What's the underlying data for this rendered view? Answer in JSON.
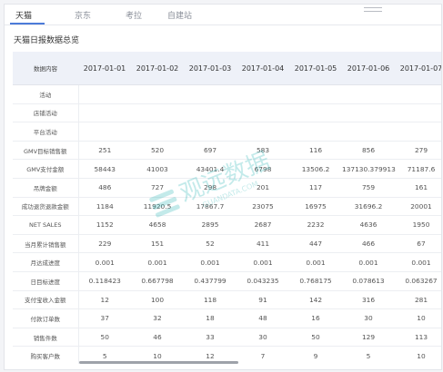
{
  "tabs": [
    {
      "label": "天猫",
      "active": true
    },
    {
      "label": "京东",
      "active": false
    },
    {
      "label": "考拉",
      "active": false
    },
    {
      "label": "自建站",
      "active": false
    }
  ],
  "panel": {
    "title": "天猫日报数据总览"
  },
  "table": {
    "corner_header": "数据内容",
    "dates": [
      "2017-01-01",
      "2017-01-02",
      "2017-01-03",
      "2017-01-04",
      "2017-01-05",
      "2017-01-06",
      "2017-01-07"
    ],
    "rows": [
      {
        "label": "活动",
        "values": [
          "",
          "",
          "",
          "",
          "",
          "",
          ""
        ]
      },
      {
        "label": "店铺活动",
        "values": [
          "",
          "",
          "",
          "",
          "",
          "",
          ""
        ]
      },
      {
        "label": "平台活动",
        "values": [
          "",
          "",
          "",
          "",
          "",
          "",
          ""
        ]
      },
      {
        "label": "GMV目标销售额",
        "values": [
          "251",
          "520",
          "697",
          "583",
          "116",
          "856",
          "279"
        ]
      },
      {
        "label": "GMV支付金额",
        "values": [
          "58443",
          "41003",
          "43401.4",
          "6798",
          "13506.2",
          "137130.379913",
          "71187.6"
        ]
      },
      {
        "label": "吊牌金额",
        "values": [
          "486",
          "727",
          "298",
          "201",
          "117",
          "759",
          "161"
        ]
      },
      {
        "label": "成功退货退款金额",
        "values": [
          "1184",
          "11920.5",
          "17867.7",
          "23075",
          "16975",
          "31696.2",
          "20001"
        ]
      },
      {
        "label": "NET SALES",
        "values": [
          "1152",
          "4658",
          "2895",
          "2687",
          "2232",
          "4636",
          "1950"
        ]
      },
      {
        "label": "当月累计销售额",
        "values": [
          "229",
          "151",
          "52",
          "411",
          "447",
          "466",
          "67"
        ]
      },
      {
        "label": "月达成进度",
        "values": [
          "0.001",
          "0.001",
          "0.001",
          "0.001",
          "0.001",
          "0.001",
          "0.001"
        ]
      },
      {
        "label": "日目标进度",
        "values": [
          "0.118423",
          "0.667798",
          "0.437799",
          "0.043235",
          "0.768175",
          "0.078613",
          "0.063267"
        ]
      },
      {
        "label": "支付宝收入金额",
        "values": [
          "12",
          "100",
          "118",
          "91",
          "142",
          "316",
          "281"
        ]
      },
      {
        "label": "付款订单数",
        "values": [
          "37",
          "32",
          "18",
          "48",
          "16",
          "30",
          "10"
        ]
      },
      {
        "label": "销售件数",
        "values": [
          "50",
          "46",
          "33",
          "30",
          "50",
          "129",
          "113"
        ]
      },
      {
        "label": "购买客户数",
        "values": [
          "5",
          "10",
          "12",
          "7",
          "9",
          "5",
          "10"
        ]
      }
    ]
  },
  "watermark": {
    "text": "观远数据",
    "subtext": "GUANDATA.COM",
    "color": "#2bb5b5"
  }
}
